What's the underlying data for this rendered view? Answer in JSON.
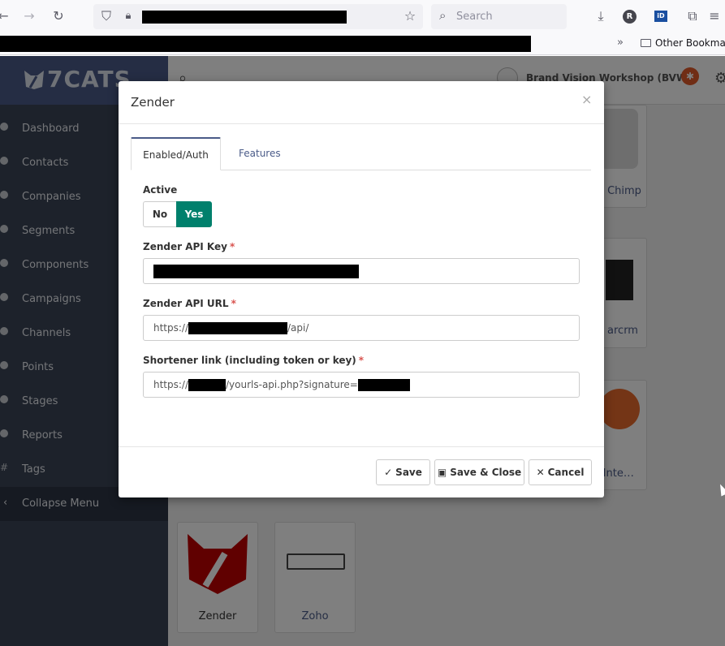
{
  "browser": {
    "search_placeholder": "Search",
    "profile_initial": "R",
    "extension_label": "iD",
    "other_bookmarks": "Other Bookmarks"
  },
  "app": {
    "logo_text": "7CATS",
    "org_name": "Brand Vision Workshop (BVW)",
    "nav": [
      "Dashboard",
      "Contacts",
      "Companies",
      "Segments",
      "Components",
      "Campaigns",
      "Channels",
      "Points",
      "Stages",
      "Reports",
      "Tags"
    ],
    "collapse_label": "Collapse Menu",
    "cards": {
      "mailchimp": "Chimp",
      "sugarcrm": "arcrm",
      "zapier": "r Inte…",
      "zender": "Zender",
      "zoho": "Zoho"
    }
  },
  "modal": {
    "title": "Zender",
    "close_symbol": "×",
    "tabs": [
      "Enabled/Auth",
      "Features"
    ],
    "active_label": "Active",
    "toggle": {
      "no": "No",
      "yes": "Yes",
      "selected": "Yes"
    },
    "fields": {
      "api_key_label": "Zender API Key",
      "api_url_label": "Zender API URL",
      "api_url_prefix": "https://",
      "api_url_suffix": "/api/",
      "shortener_label": "Shortener link (including token or key)",
      "shortener_prefix": "https://",
      "shortener_suffix": "/yourls-api.php?signature=",
      "required_mark": "*"
    },
    "buttons": {
      "save": "Save",
      "save_close": "Save & Close",
      "cancel": "Cancel"
    }
  }
}
